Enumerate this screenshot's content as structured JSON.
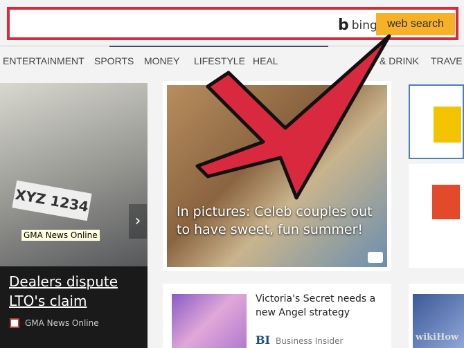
{
  "search": {
    "placeholder": "",
    "brand": "bing",
    "button": "web search"
  },
  "nav": [
    "ENTERTAINMENT",
    "SPORTS",
    "MONEY",
    "LIFESTYLE",
    "HEALTH",
    "FOOD & DRINK",
    "TRAVEL"
  ],
  "nav_visible": [
    "ENTERTAINMENT",
    "SPORTS",
    "MONEY",
    "LIFESTYLE",
    "HEAL",
    "& DRINK",
    "TRAVE"
  ],
  "left_story": {
    "plate": "XYZ 1234",
    "badge": "GMA News Online",
    "headline": "Dealers dispute LTO's claim",
    "source": "GMA News Online"
  },
  "mid_story": {
    "caption": "In pictures: Celeb couples out to have sweet, fun summer!"
  },
  "bottom_story": {
    "title": "Victoria's Secret needs a new Angel strategy",
    "source_logo": "BI",
    "source": "Business Insider"
  },
  "watermark": "wikiHow",
  "colors": {
    "highlight": "#d9293f",
    "button": "#f6b128",
    "arrow": "#d9293f"
  }
}
